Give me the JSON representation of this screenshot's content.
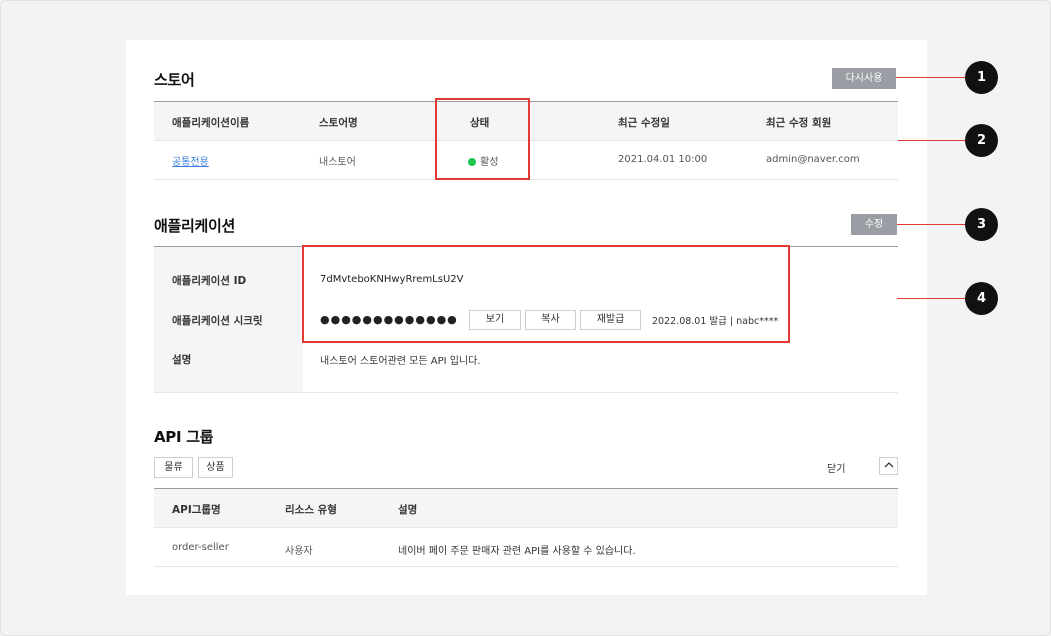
{
  "store": {
    "title": "스토어",
    "reuse_button": "다시사용",
    "columns": [
      "애플리케이션이름",
      "스토어명",
      "상태",
      "최근 수정일",
      "최근 수정 회원"
    ],
    "row": {
      "app_name": "공통전용",
      "store_name": "내스토어",
      "status": "활성",
      "status_color": "#1fc34d",
      "modified_date": "2021.04.01 10:00",
      "modified_member": "admin@naver.com"
    }
  },
  "application": {
    "title": "애플리케이션",
    "edit_button": "수정",
    "id_label": "애플리케이션 ID",
    "id_value": "7dMvteboKNHwyRremLsU2V",
    "secret_label": "애플리케이션 시크릿",
    "secret_value": "●●●●●●●●●●●●●",
    "view_button": "보기",
    "copy_button": "복사",
    "reissue_button": "재발급",
    "issue_info": "2022.08.01 발급 | nabc****",
    "desc_label": "설명",
    "desc_value": "내스토어 스토어관련 모든 API 입니다."
  },
  "api_group": {
    "title": "API 그룹",
    "filters": [
      "물류",
      "상품"
    ],
    "close_label": "닫기",
    "columns": [
      "API그룹명",
      "리소스 유형",
      "설명"
    ],
    "row": {
      "name": "order-seller",
      "resource_type": "사용자",
      "description": "네이버 페이 주문 판매자 관련 API를 사용할 수 있습니다."
    }
  },
  "callouts": [
    "1",
    "2",
    "3",
    "4"
  ],
  "colors": {
    "highlight": "#e03b32",
    "button_gray": "#9a9da3",
    "link": "#3b7de0"
  }
}
